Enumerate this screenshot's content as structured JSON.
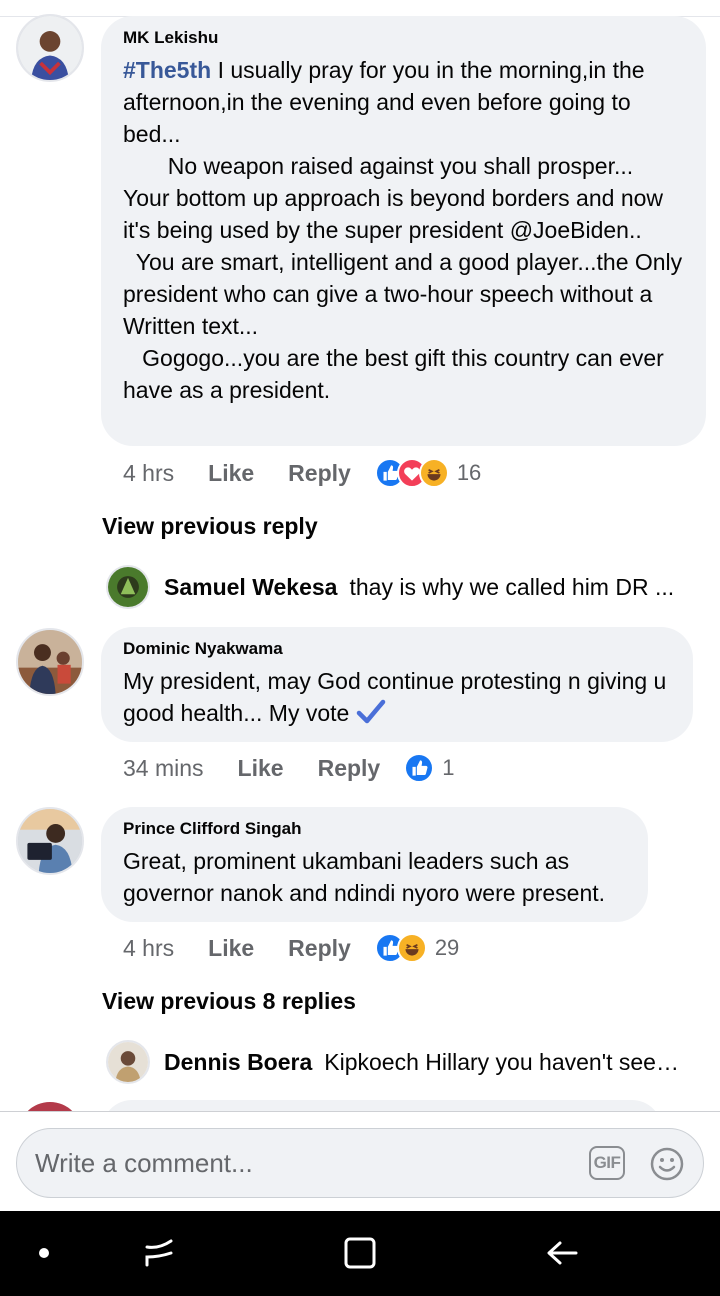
{
  "comments": [
    {
      "author": "MK Lekishu",
      "hashtag": "#The5th",
      "text": " I usually pray for you in the morning,in the afternoon,in the evening and even before going to bed...\n       No weapon raised against you shall prosper...\nYour bottom up approach is beyond borders and now it's being used by the super president @JoeBiden..\n  You are smart, intelligent and a good player...the Only president who can give a two-hour speech without a Written text...\n   Gogogo...you are the best gift this country can ever have as a president.",
      "time": "4 hrs",
      "like_label": "Like",
      "reply_label": "Reply",
      "reactions": [
        "like-icon",
        "love-icon",
        "haha-icon"
      ],
      "reaction_count": "16"
    },
    {
      "author": "Dominic Nyakwama",
      "text": "My president, may God continue protesting n giving u good health... My vote ",
      "time": "34 mins",
      "like_label": "Like",
      "reply_label": "Reply",
      "reactions": [
        "like-icon"
      ],
      "reaction_count": "1"
    },
    {
      "author": "Prince Clifford Singah",
      "text": "Great, prominent ukambani leaders such as governor nanok and ndindi nyoro were present.",
      "time": "4 hrs",
      "like_label": "Like",
      "reply_label": "Reply",
      "reactions": [
        "like-icon",
        "haha-icon"
      ],
      "reaction_count": "29"
    }
  ],
  "thread1": {
    "view_previous": "View previous reply",
    "preview_name": "Samuel Wekesa",
    "preview_text": "thay is why we called him DR ..."
  },
  "thread2": {
    "view_previous": "View previous 8 replies",
    "preview_name": "Dennis Boera",
    "preview_text": "Kipkoech Hillary you haven't seen..."
  },
  "composer": {
    "placeholder": "Write a comment...",
    "gif_label": "GIF"
  },
  "colors": {
    "like_blue": "#1877f2",
    "love_red": "#f33e58",
    "haha_yellow": "#f7b125",
    "bubble_bg": "#f0f2f5",
    "hashtag_blue": "#385898"
  }
}
